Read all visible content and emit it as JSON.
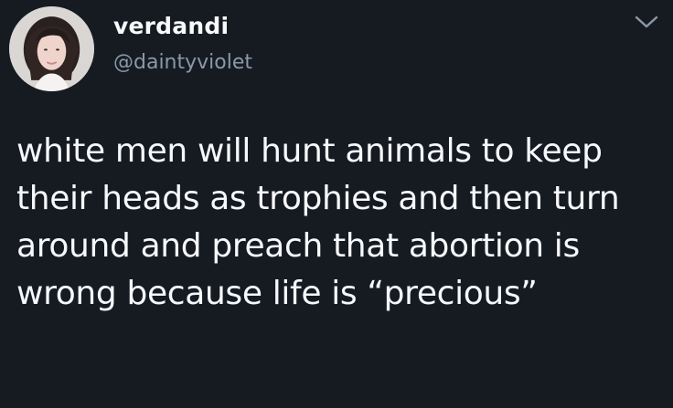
{
  "tweet": {
    "user": {
      "display_name": "verdandi",
      "handle": "@daintyviolet",
      "avatar_icon": "profile-avatar"
    },
    "menu_icon": "chevron-down-icon",
    "text": "white men will hunt animals to keep their heads as trophies and then turn around and preach that abortion is wrong because life is “precious”"
  },
  "theme": {
    "background": "#161b22",
    "text": "#f6f8fb",
    "secondary_text": "#8b98a8",
    "icon": "#8b98a8"
  }
}
